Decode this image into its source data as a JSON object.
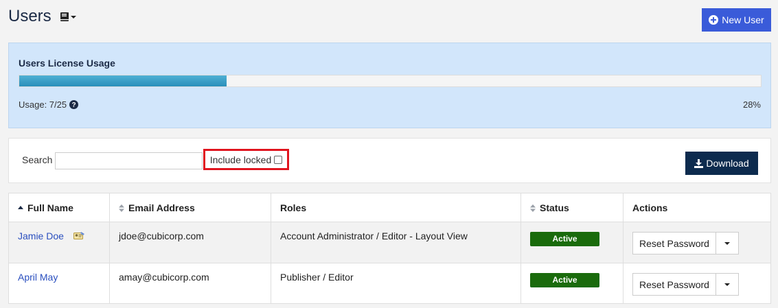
{
  "header": {
    "title": "Users",
    "new_user_label": "New User"
  },
  "license": {
    "title": "Users License Usage",
    "usage_text": "Usage: 7/25",
    "percent_text": "28%",
    "progress_fraction": 0.28
  },
  "filters": {
    "search_label": "Search",
    "search_value": "",
    "include_locked_label": "Include locked",
    "include_locked_checked": false,
    "download_label": "Download"
  },
  "table": {
    "columns": [
      "Full Name",
      "Email Address",
      "Roles",
      "Status",
      "Actions"
    ],
    "rows": [
      {
        "full_name": "Jamie Doe",
        "email": "jdoe@cubicorp.com",
        "roles": "Account Administrator / Editor - Layout View",
        "status": "Active",
        "action": "Reset Password"
      },
      {
        "full_name": "April May",
        "email": "amay@cubicorp.com",
        "roles": "Publisher / Editor",
        "status": "Active",
        "action": "Reset Password"
      }
    ]
  },
  "colors": {
    "primary_button": "#3a5bd9",
    "download_button": "#0d2b4e",
    "status_active": "#1a6b0c",
    "license_panel": "#d2e6fb",
    "highlight_border": "#e0141e"
  },
  "icons": [
    "book-icon",
    "plus-circle-icon",
    "help-icon",
    "download-icon",
    "id-card-icon",
    "sort-icon",
    "caret-down-icon"
  ]
}
